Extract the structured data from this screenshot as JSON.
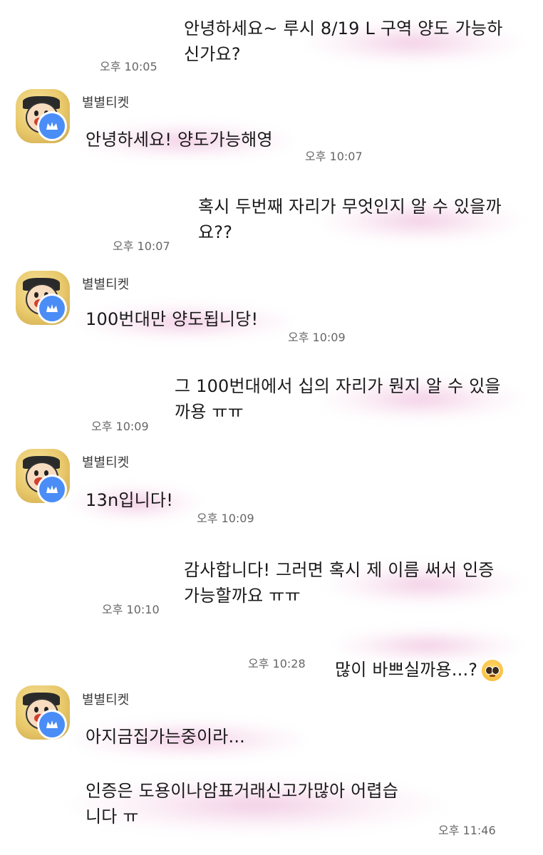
{
  "sender_name": "별별티켓",
  "messages": [
    {
      "id": "m1",
      "side": "right",
      "text": "안녕하세요~ 루시 8/19 L 구역 양도 가능하\n신가요?",
      "time": "오후 10:05"
    },
    {
      "id": "m2",
      "side": "left",
      "text": "안녕하세요! 양도가능해영",
      "time": "오후 10:07"
    },
    {
      "id": "m3",
      "side": "right",
      "text": "혹시 두번째 자리가 무엇인지 알 수 있을까\n요??",
      "time": "오후 10:07"
    },
    {
      "id": "m4",
      "side": "left",
      "text": "100번대만 양도됩니당!",
      "time": "오후 10:09"
    },
    {
      "id": "m5",
      "side": "right",
      "text": "그 100번대에서 십의 자리가 뭔지 알 수 있을\n까용 ㅠㅠ",
      "time": "오후 10:09"
    },
    {
      "id": "m6",
      "side": "left",
      "text": "13n입니다!",
      "time": "오후 10:09"
    },
    {
      "id": "m7",
      "side": "right",
      "text": "감사합니다! 그러면 혹시 제 이름 써서 인증\n가능할까요 ㅠㅠ",
      "time": "오후 10:10"
    },
    {
      "id": "m8",
      "side": "right",
      "text": "많이 바쁘실까용...?",
      "time": "오후 10:28",
      "emoji": "pleading-face-emoji"
    },
    {
      "id": "m9",
      "side": "left",
      "text": "아지금집가는중이라...",
      "time": ""
    },
    {
      "id": "m10",
      "side": "left",
      "text": "인증은 도용이나암표거래신고가많아 어렵습\n니다 ㅠ",
      "time": "오후 11:46"
    }
  ],
  "colors": {
    "badge": "#4a8df6",
    "smear": "#e496c8",
    "time": "#666666"
  }
}
